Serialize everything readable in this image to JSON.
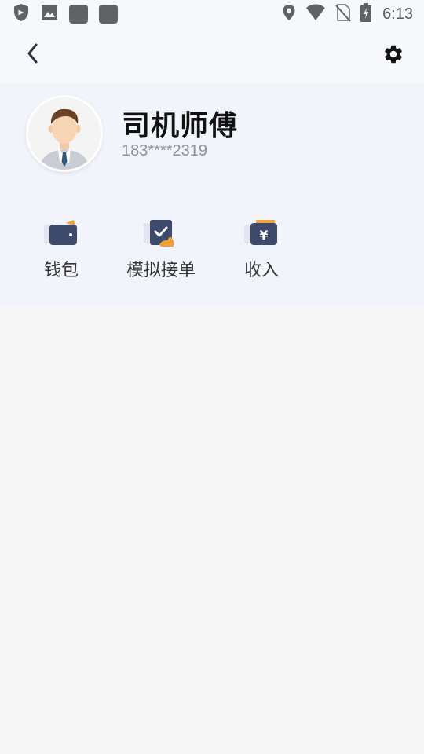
{
  "status_bar": {
    "time": "6:13",
    "left_icons": [
      "shield-icon",
      "image-icon",
      "app-square-icon",
      "app-square-icon"
    ],
    "right_icons": [
      "location-icon",
      "wifi-icon",
      "no-sim-icon",
      "battery-charging-icon"
    ]
  },
  "toolbar": {
    "back_icon": "chevron-left-icon",
    "settings_icon": "gear-icon"
  },
  "profile": {
    "name": "司机师傅",
    "phone": "183****2319"
  },
  "menu": {
    "items": [
      {
        "label": "钱包",
        "icon": "wallet-icon"
      },
      {
        "label": "模拟接单",
        "icon": "simulate-order-icon"
      },
      {
        "label": "收入",
        "icon": "income-icon"
      }
    ]
  },
  "colors": {
    "header_bg": "#f7f8fc",
    "profile_bg": "#f1f4fb",
    "page_bg": "#f7f7f7",
    "icon_navy": "#3d4a6b",
    "icon_accent": "#f0a23a"
  }
}
